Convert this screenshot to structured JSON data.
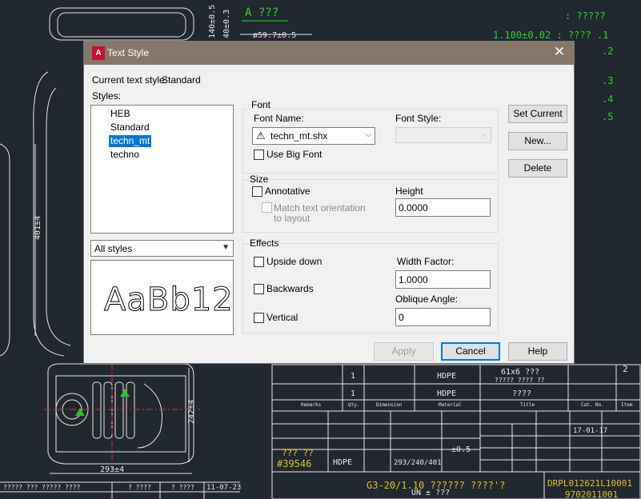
{
  "background": {
    "row_1": {
      "num": "1",
      "material": "HDPE",
      "desc": "61x6 ???",
      "desc2": "????? ???? ??"
    },
    "row_2": {
      "num": "1",
      "material": "HDPE",
      "desc": "????"
    },
    "header_cells": [
      "Remarks",
      "Qty.",
      "Dimension",
      "Material",
      "Title",
      "Cat. No.",
      "Item"
    ],
    "dept_code": "??? ??",
    "number_code": "#39546",
    "material_cell": "HDPE",
    "dimension": "293/240/401",
    "tolerance": "±0.5",
    "date": "17-01-17",
    "title_block": "G3-20/1.10 ?????? ????'?",
    "drawing_number": "DRPL012621L10001",
    "sub_number": "9702011001",
    "sheet_number": "2",
    "dims": {
      "d1": "ø59.7±0.5",
      "d2": "401±4",
      "d3": "242±4",
      "d4": "293±4",
      "d5": "140±0.5",
      "d6": "40±0.3"
    },
    "section_label": "A ???",
    "note_items": [
      "1.100±0.02 : ???? .1",
      ".2",
      ".3",
      ".4",
      ".5"
    ],
    "note_header": ": ?????",
    "bottom_left": [
      "????? ??? ????? ????",
      "? ????",
      "? ????",
      "11-07-23"
    ],
    "un_text": "UN ± ???"
  },
  "dialog": {
    "app_icon_label": "A",
    "title": "Text Style",
    "current_style_label": "Current text style:",
    "current_style_value": "Standard",
    "styles_label": "Styles:",
    "styles": [
      "HEB",
      "Standard",
      "techn_mt",
      "techno"
    ],
    "selected_style": "techn_mt",
    "filter_value": "All styles",
    "preview_text": "AaBb12",
    "font_group": "Font",
    "font_name_label": "Font Name:",
    "font_name_value": "techn_mt.shx",
    "font_style_label": "Font Style:",
    "font_style_value": "",
    "use_big_font_label": "Use Big Font",
    "size_group": "Size",
    "annotative_label": "Annotative",
    "match_orientation_label_1": "Match text orientation",
    "match_orientation_label_2": "to layout",
    "height_label": "Height",
    "height_value": "0.0000",
    "effects_group": "Effects",
    "upside_down_label": "Upside down",
    "backwards_label": "Backwards",
    "vertical_label": "Vertical",
    "width_factor_label": "Width Factor:",
    "width_factor_value": "1.0000",
    "oblique_label": "Oblique Angle:",
    "oblique_value": "0",
    "set_current_button": "Set Current",
    "new_button": "New...",
    "delete_button": "Delete",
    "apply_button": "Apply",
    "cancel_button": "Cancel",
    "help_button": "Help"
  }
}
